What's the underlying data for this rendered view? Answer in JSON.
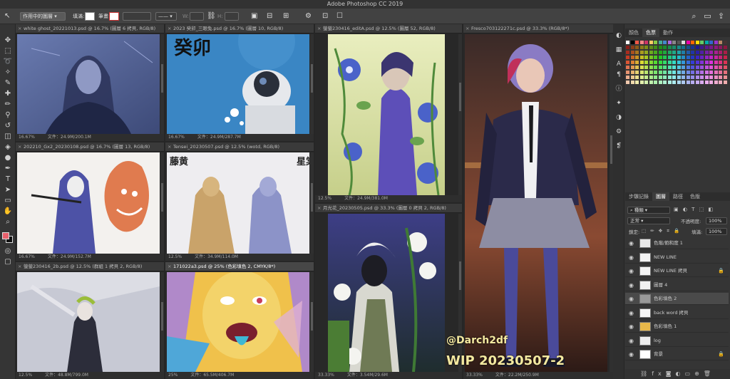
{
  "app": {
    "title": "Adobe Photoshop CC 2019"
  },
  "options": {
    "layer_select": "作用中的圖層",
    "fill_label": "填滿:",
    "stroke_label": "筆畫:",
    "w_label": "W:",
    "h_label": "H:"
  },
  "documents": [
    {
      "tab": "white ghost_20221013.psd @ 16.7% (圖層 6 拷貝, RGB/8)",
      "zoom": "16.67%",
      "size": "文件：24.9M/200.1M"
    },
    {
      "tab": "2023 癸卯_三眼兔.psd @ 16.7% (圖層 10, RGB/8)",
      "zoom": "16.67%",
      "size": "文件：24.9M/287.7M"
    },
    {
      "tab": "202210_Gx2_20230108.psd @ 16.7% (圖層 13, RGB/8)",
      "zoom": "16.67%",
      "size": "文件：24.9M/152.7M"
    },
    {
      "tab": "Tensei_20230507.psd @ 12.5% (wotd, RGB/8)",
      "zoom": "12.5%",
      "size": "文件：34.9M/114.0M"
    },
    {
      "tab": "螢螢230416_2b.psd @ 12.5% (群組 1 拷貝 2, RGB/8)",
      "zoom": "12.5%",
      "size": "文件：48.8M/799.0M"
    },
    {
      "tab": "171022a3.psd @ 25% (色彩填色 2, CMYK/8*)",
      "zoom": "25%",
      "size": "文件：65.5M/406.7M"
    },
    {
      "tab": "螢螢230416_editA.psd @ 12.5% (圖層 52, RGB/8)",
      "zoom": "12.5%",
      "size": "文件：24.9M/381.0M"
    },
    {
      "tab": "月光花_20230505.psd @ 33.3% (圖層 0 拷貝 2, RGB/8)",
      "zoom": "33.33%",
      "size": "文件：3.54M/29.6M"
    },
    {
      "tab": "Fresco703122271c.psd @ 33.3% (RGB/8*)",
      "zoom": "33.33%",
      "size": "文件：22.2M/250.9M"
    }
  ],
  "artwork_text": {
    "kuimao": "癸卯",
    "teng": "藤黄",
    "xing": "星棠",
    "handle": "@Darch2df",
    "wip": "WIP 20230507-2"
  },
  "panels": {
    "top_tabs": [
      "顏色",
      "色票",
      "動作"
    ],
    "layer_tabs": [
      "步驟記錄",
      "圖層",
      "路徑",
      "色版"
    ],
    "kind_filter": "種類",
    "blend_mode": "正常",
    "opacity_label": "不透明度:",
    "opacity": "100%",
    "lock_label": "鎖定:",
    "fill_label": "填滿:",
    "fill": "100%",
    "layers": [
      {
        "name": "色階/飽和度 1",
        "selected": false,
        "locked": false
      },
      {
        "name": "NEW LINE",
        "selected": false,
        "locked": false
      },
      {
        "name": "NEW LINE 拷貝",
        "selected": false,
        "locked": true
      },
      {
        "name": "圖層 4",
        "selected": false,
        "locked": false
      },
      {
        "name": "色彩填色 2",
        "selected": true,
        "locked": false
      },
      {
        "name": "back word 拷貝",
        "selected": false,
        "locked": false
      },
      {
        "name": "色彩填色 1",
        "selected": false,
        "locked": false
      },
      {
        "name": "log",
        "selected": false,
        "locked": false
      },
      {
        "name": "背景",
        "selected": false,
        "locked": true
      }
    ]
  },
  "colors": {
    "accent": "#e8606c",
    "panel_bg": "#353535",
    "selected_layer": "#4a4a4a"
  }
}
